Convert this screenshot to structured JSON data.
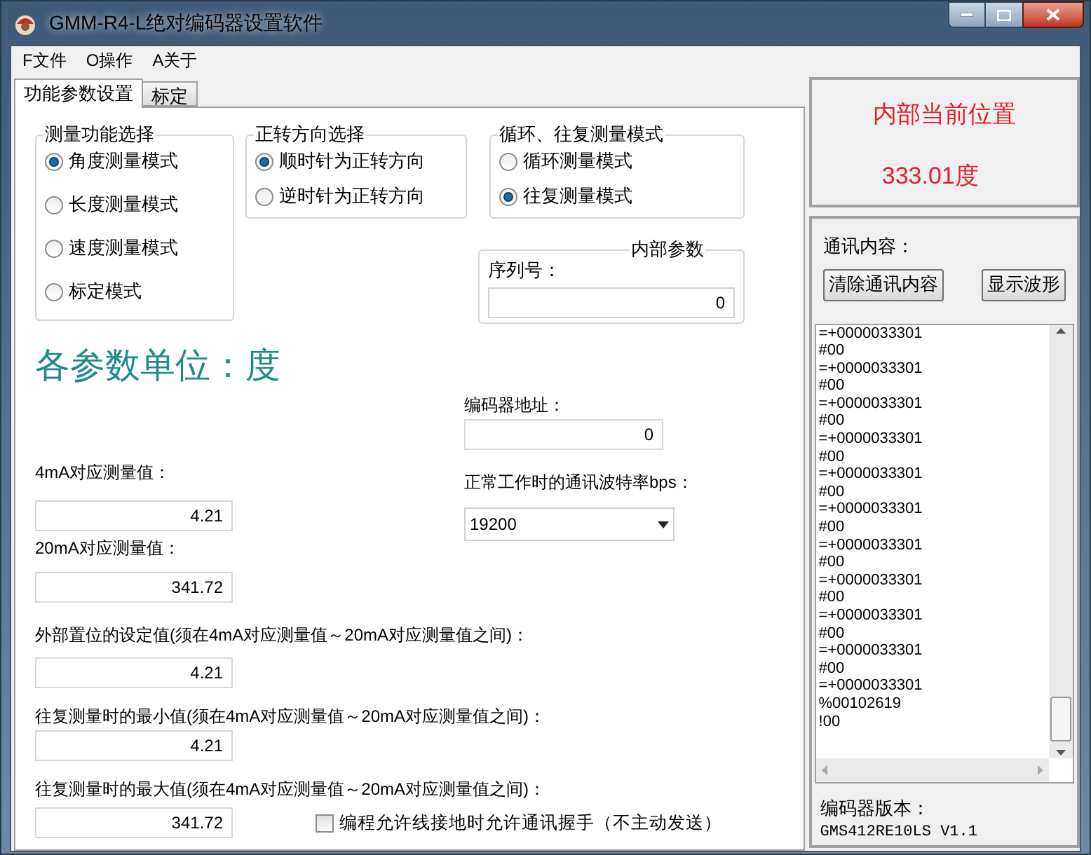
{
  "window": {
    "title": "GMM-R4-L绝对编码器设置软件"
  },
  "menu": [
    "F文件",
    "O操作",
    "A关于"
  ],
  "tabs": [
    {
      "label": "功能参数设置",
      "selected": true
    },
    {
      "label": "标定",
      "selected": false
    }
  ],
  "measure_mode": {
    "title": "测量功能选择",
    "options": [
      {
        "label": "角度测量模式",
        "selected": true
      },
      {
        "label": "长度测量模式",
        "selected": false
      },
      {
        "label": "速度测量模式",
        "selected": false
      },
      {
        "label": "标定模式",
        "selected": false
      }
    ]
  },
  "direction": {
    "title": "正转方向选择",
    "options": [
      {
        "label": "顺时针为正转方向",
        "selected": true
      },
      {
        "label": "逆时针为正转方向",
        "selected": false
      }
    ]
  },
  "loop_mode": {
    "title": "循环、往复测量模式",
    "options": [
      {
        "label": "循环测量模式",
        "selected": false
      },
      {
        "label": "往复测量模式",
        "selected": true
      }
    ]
  },
  "internal_params": {
    "title": "内部参数",
    "serial_label": "序列号：",
    "serial_value": "0"
  },
  "unit_banner": "各参数单位：度",
  "address": {
    "label": "编码器地址：",
    "value": "0"
  },
  "baud": {
    "label": "正常工作时的通讯波特率bps：",
    "value": "19200"
  },
  "ma4": {
    "label": "4mA对应测量值：",
    "value": "4.21"
  },
  "ma20": {
    "label": "20mA对应测量值：",
    "value": "341.72"
  },
  "reset_value": {
    "label": "外部置位的设定值(须在4mA对应测量值～20mA对应测量值之间)：",
    "value": "4.21"
  },
  "min_value": {
    "label": "往复测量时的最小值(须在4mA对应测量值～20mA对应测量值之间)：",
    "value": "4.21"
  },
  "max_value": {
    "label": "往复测量时的最大值(须在4mA对应测量值～20mA对应测量值之间)：",
    "value": "341.72"
  },
  "handshake": {
    "label": "编程允许线接地时允许通讯握手（不主动发送）",
    "checked": false
  },
  "position_panel": {
    "title": "内部当前位置",
    "value": "333.01度"
  },
  "comm": {
    "label": "通讯内容：",
    "buttons": [
      "清除通讯内容",
      "显示波形"
    ],
    "log": [
      "=+0000033301",
      "#00",
      "=+0000033301",
      "#00",
      "=+0000033301",
      "#00",
      "=+0000033301",
      "#00",
      "=+0000033301",
      "#00",
      "=+0000033301",
      "#00",
      "=+0000033301",
      "#00",
      "=+0000033301",
      "#00",
      "=+0000033301",
      "#00",
      "=+0000033301",
      "#00",
      "=+0000033301",
      "%00102619",
      "!00"
    ]
  },
  "version": {
    "label": "编码器版本：",
    "value": "GMS412RE10LS V1.1"
  }
}
